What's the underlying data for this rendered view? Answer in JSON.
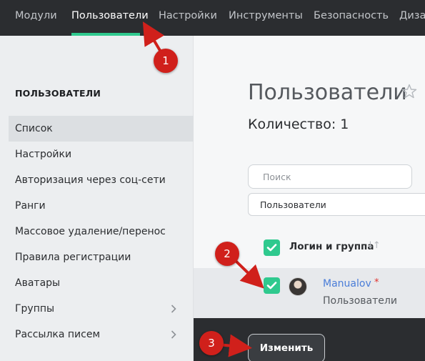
{
  "topnav": {
    "items": [
      "Модули",
      "Пользователи",
      "Настройки",
      "Инструменты",
      "Безопасность",
      "Дизайн"
    ],
    "active_index": 1
  },
  "sidebar": {
    "title": "ПОЛЬЗОВАТЕЛИ",
    "items": [
      {
        "label": "Список",
        "active": true
      },
      {
        "label": "Настройки"
      },
      {
        "label": "Авторизация через соц-сети"
      },
      {
        "label": "Ранги"
      },
      {
        "label": "Массовое удаление/перенос"
      },
      {
        "label": "Правила регистрации"
      },
      {
        "label": "Аватары"
      },
      {
        "label": "Группы",
        "chevron": "chevron-right-icon"
      },
      {
        "label": "Рассылка писем",
        "chevron": "chevron-right-icon"
      }
    ]
  },
  "main": {
    "title": "Пользователи",
    "count_label": "Количество: 1",
    "search_placeholder": "Поиск",
    "group_filter": "Пользователи",
    "column_header": "Логин и группа",
    "rows": [
      {
        "login": "Manualov",
        "required_mark": "*",
        "group": "Пользователи",
        "checked": true
      }
    ]
  },
  "bottombar": {
    "change_label": "Изменить"
  },
  "annotations": [
    "1",
    "2",
    "3"
  ],
  "colors": {
    "accent": "#2fc98e",
    "nav_bg": "#2b2d30",
    "link": "#4a7dd8",
    "marker": "#d0201b"
  }
}
